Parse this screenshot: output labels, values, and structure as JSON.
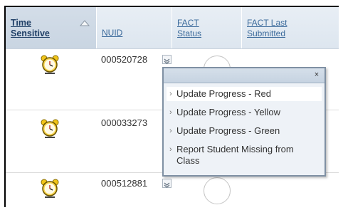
{
  "columns": {
    "time_sensitive": "Time Sensitive",
    "nuid": "NUID",
    "fact_status": "FACT Status",
    "fact_last_submitted": "FACT Last Submitted"
  },
  "rows": [
    {
      "nuid": "000520728"
    },
    {
      "nuid": "000033273"
    },
    {
      "nuid": "000512881"
    }
  ],
  "popup": {
    "close_symbol": "×",
    "items": [
      "Update Progress - Red",
      "Update Progress - Yellow",
      "Update Progress - Green",
      "Report Student Missing from Class"
    ]
  },
  "colors": {
    "header_link": "#3b6a9b",
    "popup_border": "#7f90a3"
  }
}
